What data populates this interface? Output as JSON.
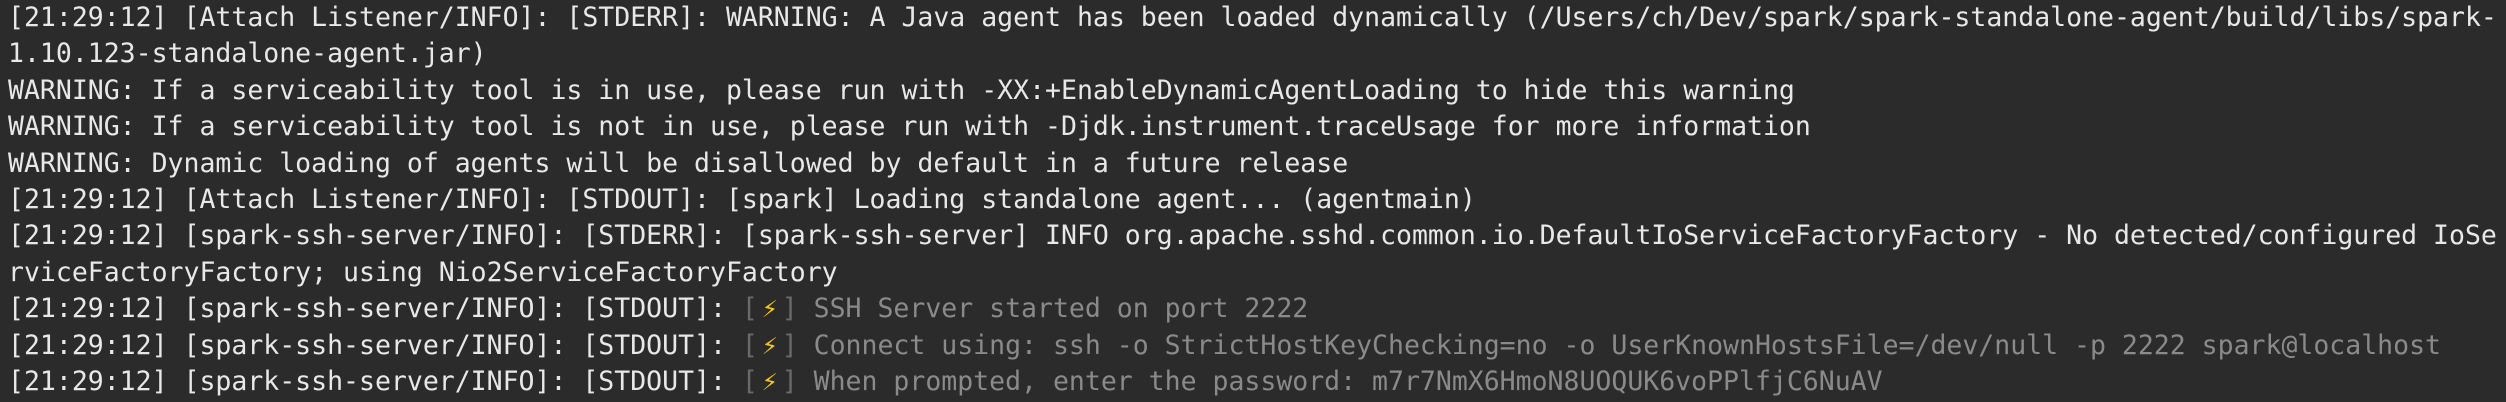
{
  "lines": [
    "[21:29:12] [Attach Listener/INFO]: [STDERR]: WARNING: A Java agent has been loaded dynamically (/Users/ch/Dev/spark/spark-standalone-agent/build/libs/spark-",
    "1.10.123-standalone-agent.jar)",
    "WARNING: If a serviceability tool is in use, please run with -XX:+EnableDynamicAgentLoading to hide this warning",
    "WARNING: If a serviceability tool is not in use, please run with -Djdk.instrument.traceUsage for more information",
    "WARNING: Dynamic loading of agents will be disallowed by default in a future release",
    "[21:29:12] [Attach Listener/INFO]: [STDOUT]: [spark] Loading standalone agent... (agentmain)",
    "[21:29:12] [spark-ssh-server/INFO]: [STDERR]: [spark-ssh-server] INFO org.apache.sshd.common.io.DefaultIoServiceFactoryFactory - No detected/configured IoSe",
    "rviceFactoryFactory; using Nio2ServiceFactoryFactory"
  ],
  "spark_lines": [
    {
      "prefix": "[21:29:12] [spark-ssh-server/INFO]: [STDOUT]: ",
      "open": "[",
      "icon": "⚡",
      "close": "]",
      "message": " SSH Server started on port 2222"
    },
    {
      "prefix": "[21:29:12] [spark-ssh-server/INFO]: [STDOUT]: ",
      "open": "[",
      "icon": "⚡",
      "close": "]",
      "message": " Connect using: ssh -o StrictHostKeyChecking=no -o UserKnownHostsFile=/dev/null -p 2222 spark@localhost"
    },
    {
      "prefix": "[21:29:12] [spark-ssh-server/INFO]: [STDOUT]: ",
      "open": "[",
      "icon": "⚡",
      "close": "]",
      "message": " When prompted, enter the password: m7r7NmX6HmoN8UOQUK6voPPlfjC6NuAV"
    }
  ],
  "colors": {
    "background": "#2b2b2b",
    "text": "#e8e8e8",
    "dim_text": "#8a8a8a",
    "bolt": "#f5c518"
  },
  "icons": {
    "spark_bolt": "lightning-bolt-icon"
  }
}
